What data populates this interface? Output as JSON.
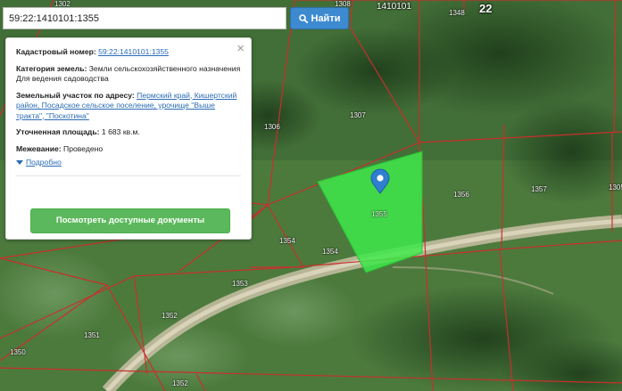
{
  "search": {
    "value": "59:22:1410101:1355",
    "button_label": "Найти"
  },
  "map_labels": {
    "quarter": "1410101",
    "district": "22",
    "parcels": [
      "1302",
      "1308",
      "1348",
      "1307",
      "1306",
      "1305",
      "1356",
      "1357",
      "1355",
      "1354",
      "1354",
      "1353",
      "1352",
      "1351",
      "1350",
      "1352"
    ]
  },
  "info": {
    "cadastral_label": "Кадастровый номер:",
    "cadastral_value": "59:22:1410101:1355",
    "category_label": "Категория земель:",
    "category_value": "Земли сельскохозяйственного назначения",
    "usage": "Для ведения садоводства",
    "address_label": "Земельный участок по адресу:",
    "address_value": "Пермский край, Кишертский район, Посадское сельское поселение, урочище \"Выше тракта\", \"Поскотина\"",
    "area_label": "Уточненная площадь:",
    "area_value": "1 683 кв.м.",
    "survey_label": "Межевание:",
    "survey_value": "Проведено",
    "details_link": "Подробно",
    "docs_button": "Посмотреть доступные документы"
  },
  "colors": {
    "parcel_fill": "#3ee84a",
    "boundary": "#c8302c",
    "search_button": "#3d8ad1",
    "docs_button": "#5cb85c",
    "marker": "#2f7fd0"
  }
}
